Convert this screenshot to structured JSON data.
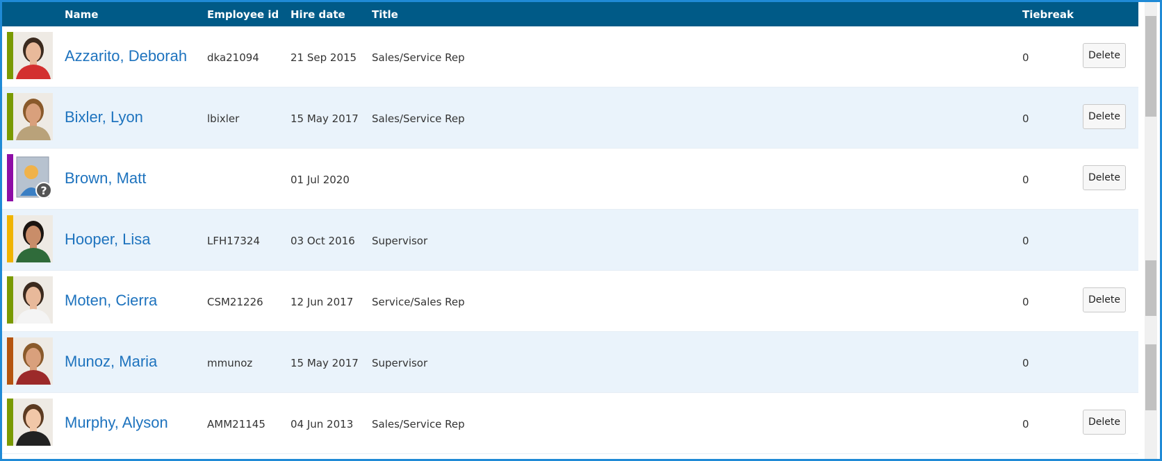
{
  "columns": {
    "name": "Name",
    "employee_id": "Employee id",
    "hire_date": "Hire date",
    "title": "Title",
    "tiebreak": "Tiebreak"
  },
  "colors": {
    "header_bg": "#005a87",
    "link": "#1e73be",
    "alt_row": "#eaf3fb",
    "frame_border": "#1f8ad6"
  },
  "employees": [
    {
      "name": "Azzarito, Deborah",
      "employee_id": "dka21094",
      "hire_date": "21 Sep 2015",
      "title": "Sales/Service Rep",
      "tiebreak": "0",
      "delete_label": "Delete",
      "has_delete": true,
      "status_color": "#7a9a01",
      "avatar": "photo-woman"
    },
    {
      "name": "Bixler, Lyon",
      "employee_id": "lbixler",
      "hire_date": "15 May 2017",
      "title": "Sales/Service Rep",
      "tiebreak": "0",
      "delete_label": "Delete",
      "has_delete": true,
      "status_color": "#7a9a01",
      "avatar": "photo-man"
    },
    {
      "name": "Brown, Matt",
      "employee_id": "",
      "hire_date": "01 Jul 2020",
      "title": "",
      "tiebreak": "0",
      "delete_label": "Delete",
      "has_delete": true,
      "status_color": "#8e0ea6",
      "avatar": "placeholder-user-icon"
    },
    {
      "name": "Hooper, Lisa",
      "employee_id": "LFH17324",
      "hire_date": "03 Oct 2016",
      "title": "Supervisor",
      "tiebreak": "0",
      "delete_label": "",
      "has_delete": false,
      "status_color": "#f0b400",
      "avatar": "photo-woman"
    },
    {
      "name": "Moten, Cierra",
      "employee_id": "CSM21226",
      "hire_date": "12 Jun 2017",
      "title": "Service/Sales Rep",
      "tiebreak": "0",
      "delete_label": "Delete",
      "has_delete": true,
      "status_color": "#7a9a01",
      "avatar": "photo-woman"
    },
    {
      "name": "Munoz, Maria",
      "employee_id": "mmunoz",
      "hire_date": "15 May 2017",
      "title": "Supervisor",
      "tiebreak": "0",
      "delete_label": "",
      "has_delete": false,
      "status_color": "#b5540f",
      "avatar": "photo-woman"
    },
    {
      "name": "Murphy, Alyson",
      "employee_id": "AMM21145",
      "hire_date": "04 Jun 2013",
      "title": "Sales/Service Rep",
      "tiebreak": "0",
      "delete_label": "Delete",
      "has_delete": true,
      "status_color": "#7a9a01",
      "avatar": "photo-woman"
    }
  ]
}
